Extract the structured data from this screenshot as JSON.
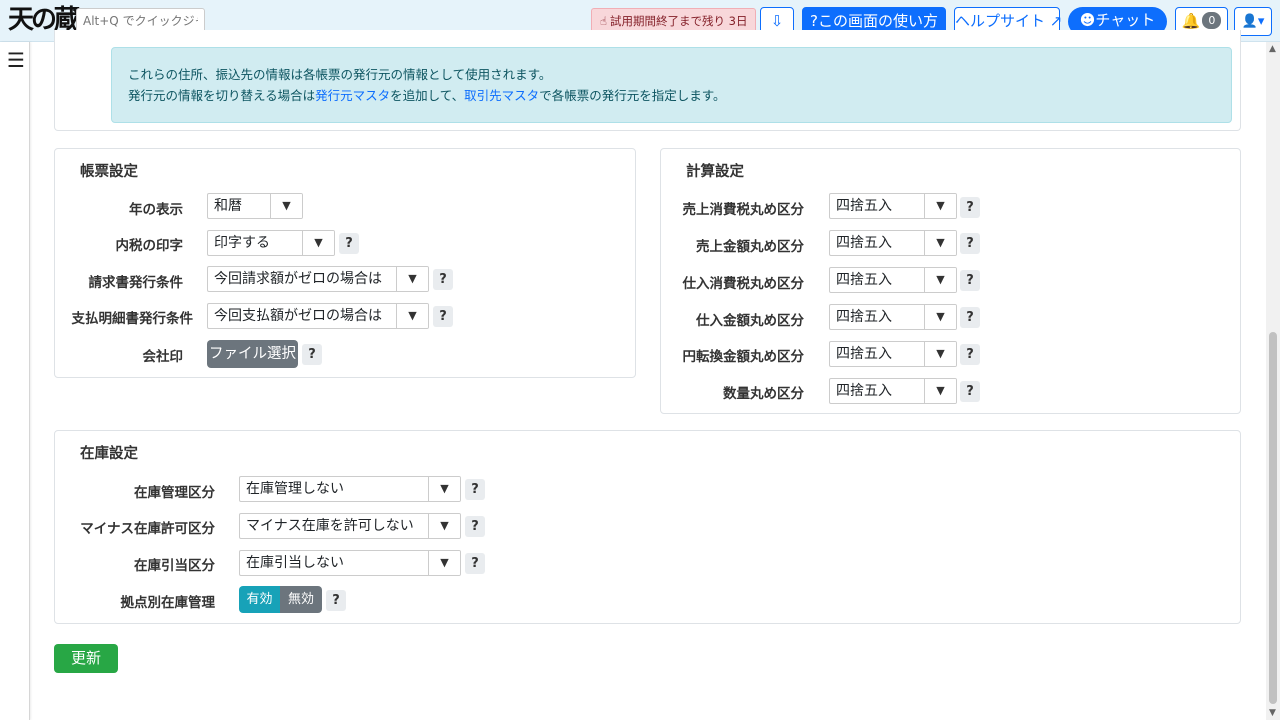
{
  "header": {
    "logo_text": "天の蔵",
    "quick_jump_placeholder": "Alt+Q でクイックジャンプ",
    "trial_text": "試用期間終了まで残り 3日",
    "howto_label": "?この画面の使い方",
    "help_site_label": "ヘルプサイト",
    "chat_label": "チャット",
    "notification_count": "0"
  },
  "info_box": {
    "line1": "これらの住所、振込先の情報は各帳票の発行元の情報として使用されます。",
    "line2_pre": "発行元の情報を切り替える場合は",
    "line2_link1": "発行元マスタ",
    "line2_mid": "を追加して、",
    "line2_link2": "取引先マスタ",
    "line2_post": "で各帳票の発行元を指定します。"
  },
  "form_settings": {
    "title": "帳票設定",
    "rows": [
      {
        "label": "年の表示",
        "value": "和暦"
      },
      {
        "label": "内税の印字",
        "value": "印字する"
      },
      {
        "label": "請求書発行条件",
        "value": "今回請求額がゼロの場合は"
      },
      {
        "label": "支払明細書発行条件",
        "value": "今回支払額がゼロの場合は"
      }
    ],
    "company_seal_label": "会社印",
    "file_button_label": "ファイル選択"
  },
  "calc_settings": {
    "title": "計算設定",
    "rows": [
      {
        "label": "売上消費税丸め区分",
        "value": "四捨五入"
      },
      {
        "label": "売上金額丸め区分",
        "value": "四捨五入"
      },
      {
        "label": "仕入消費税丸め区分",
        "value": "四捨五入"
      },
      {
        "label": "仕入金額丸め区分",
        "value": "四捨五入"
      },
      {
        "label": "円転換金額丸め区分",
        "value": "四捨五入"
      },
      {
        "label": "数量丸め区分",
        "value": "四捨五入"
      }
    ]
  },
  "stock_settings": {
    "title": "在庫設定",
    "rows": [
      {
        "label": "在庫管理区分",
        "value": "在庫管理しない"
      },
      {
        "label": "マイナス在庫許可区分",
        "value": "マイナス在庫を許可しない"
      },
      {
        "label": "在庫引当区分",
        "value": "在庫引当しない"
      }
    ],
    "branch_stock_label": "拠点別在庫管理",
    "toggle_on": "有効",
    "toggle_off": "無効"
  },
  "help_mark": "?",
  "update_label": "更新",
  "colors": {
    "primary": "#0d6efd",
    "info_bg": "#d1ecf1",
    "success": "#28a745",
    "toggle_active": "#17a2b8",
    "secondary": "#6c757d"
  }
}
